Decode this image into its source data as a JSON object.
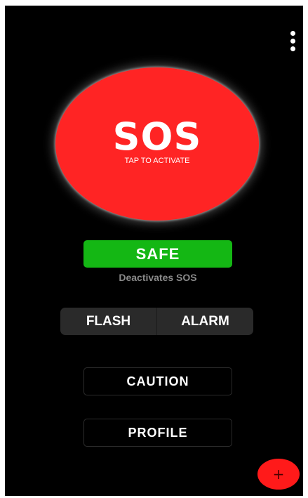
{
  "sos": {
    "title": "SOS",
    "subtitle": "TAP TO ACTIVATE",
    "color": "#ff2424"
  },
  "safe": {
    "label": "SAFE",
    "caption": "Deactivates SOS",
    "color": "#14b714"
  },
  "toggles": {
    "flash_label": "FLASH",
    "alarm_label": "ALARM"
  },
  "buttons": {
    "caution_label": "CAUTION",
    "profile_label": "PROFILE"
  },
  "menu": {
    "icon": "more-vertical-icon"
  },
  "fab": {
    "icon": "plus-icon",
    "symbol": "+",
    "color": "#ff1a1a"
  }
}
